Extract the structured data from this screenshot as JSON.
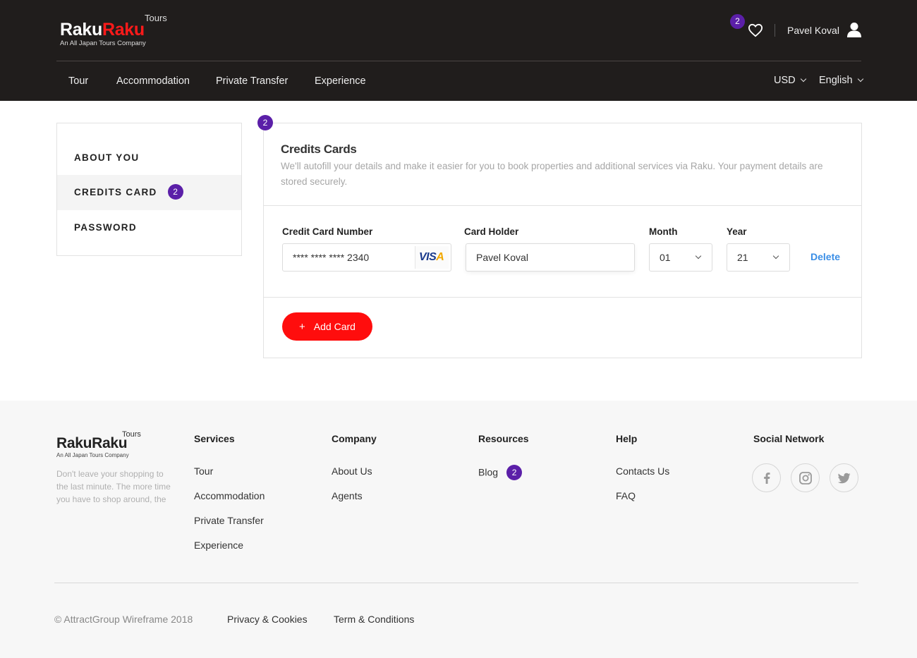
{
  "header": {
    "logo": {
      "tours": "Tours",
      "raku1": "Raku",
      "raku2": "Raku",
      "subtitle": "An All Japan Tours Company"
    },
    "wishlist_badge": "2",
    "user_name": "Pavel Koval",
    "nav": [
      "Tour",
      "Accommodation",
      "Private Transfer",
      "Experience"
    ],
    "currency": "USD",
    "language": "English"
  },
  "sidebar": {
    "items": [
      {
        "label": "ABOUT YOU"
      },
      {
        "label": "CREDITS CARD",
        "badge": "2"
      },
      {
        "label": "PASSWORD"
      }
    ]
  },
  "panel": {
    "badge": "2",
    "title": "Credits Cards",
    "description": "We'll autofill your details and make it easier for you to book properties and additional services via Raku. Your payment details are stored securely.",
    "labels": {
      "card_number": "Credit Card Number",
      "card_holder": "Card Holder",
      "month": "Month",
      "year": "Year"
    },
    "card": {
      "number": "**** **** **** 2340",
      "brand": "VISA",
      "holder": "Pavel Koval",
      "month": "01",
      "year": "21"
    },
    "delete_label": "Delete",
    "add_label": "Add Card",
    "add_icon": "+"
  },
  "footer": {
    "logo": {
      "tours": "Tours",
      "main": "RakuRaku",
      "subtitle": "An All Japan Tours Company"
    },
    "tagline": "Don't leave your shopping to the last minute. The more time you have to shop around, the",
    "columns": {
      "services": {
        "title": "Services",
        "links": [
          "Tour",
          "Accommodation",
          "Private Transfer",
          "Experience"
        ]
      },
      "company": {
        "title": "Company",
        "links": [
          "About Us",
          "Agents"
        ]
      },
      "resources": {
        "title": "Resources",
        "links": [
          "Blog"
        ],
        "badge": "2"
      },
      "help": {
        "title": "Help",
        "links": [
          "Contacts Us",
          "FAQ"
        ]
      },
      "social": {
        "title": "Social Network",
        "icons": [
          "facebook-icon",
          "instagram-icon",
          "twitter-icon"
        ]
      }
    },
    "copyright": "© AttractGroup Wireframe  2018",
    "privacy": "Privacy & Cookies",
    "terms": "Term & Conditions"
  },
  "colors": {
    "header_bg": "#201d1c",
    "accent_red": "#ff0d0d",
    "badge_purple": "#5b1fa8",
    "link_blue": "#3a8ee6"
  }
}
